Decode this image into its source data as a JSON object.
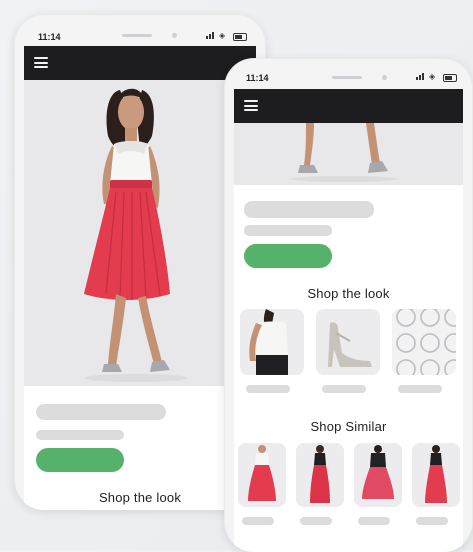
{
  "phone_left": {
    "status": {
      "time": "11:14"
    },
    "section_title": "Shop the look"
  },
  "phone_right": {
    "status": {
      "time": "11:14"
    },
    "shop_the_look_title": "Shop the look",
    "shop_similar_title": "Shop Similar"
  },
  "colors": {
    "navbar": "#1d1d1f",
    "cta": "#56b26a",
    "skeleton": "#dcdcdc",
    "skirt": "#e23c4e"
  },
  "icons": [
    "menu-icon",
    "signal-icon",
    "wifi-icon",
    "battery-icon"
  ]
}
